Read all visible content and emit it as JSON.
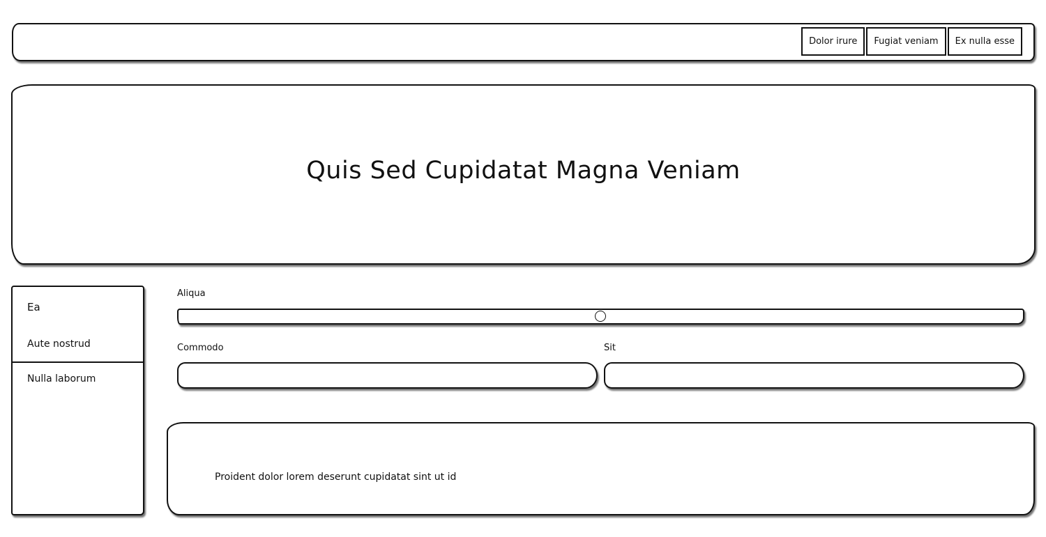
{
  "navbar": {
    "buttons": [
      {
        "label": "Dolor irure"
      },
      {
        "label": "Fugiat veniam"
      },
      {
        "label": "Ex nulla esse"
      }
    ]
  },
  "hero": {
    "title": "Quis Sed Cupidatat Magna Veniam"
  },
  "sidebar": {
    "items": [
      {
        "label": "Ea"
      },
      {
        "label": "Aute nostrud"
      },
      {
        "label": "Nulla laborum"
      }
    ]
  },
  "form": {
    "slider": {
      "label": "Aliqua",
      "value_fraction": 0.5
    },
    "commodo": {
      "label": "Commodo",
      "value": ""
    },
    "sit": {
      "label": "Sit",
      "value": ""
    }
  },
  "content": {
    "text": "Proident dolor lorem deserunt cupidatat sint ut id"
  }
}
